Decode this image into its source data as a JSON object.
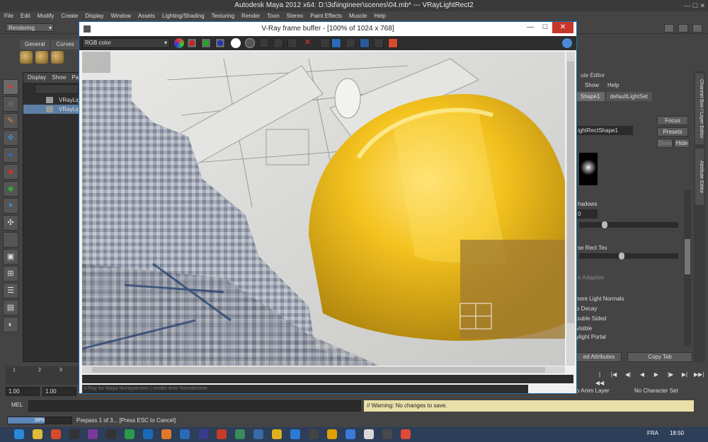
{
  "maya": {
    "title": "Autodesk Maya 2012 x64: D:\\3d\\ingineer\\scenes\\04.mb*   ---   VRayLightRect2",
    "menu": [
      "File",
      "Edit",
      "Modify",
      "Create",
      "Display",
      "Window",
      "Assets",
      "Lighting/Shading",
      "Texturing",
      "Render",
      "Toon",
      "Stereo",
      "Paint Effects",
      "Muscle",
      "Help"
    ],
    "mode": "Rendering",
    "shelf_tabs": [
      "General",
      "Curves"
    ]
  },
  "outliner": {
    "menu": [
      "Display",
      "Show",
      "Pa"
    ],
    "items": [
      "VRayLight",
      "VRayLigh"
    ]
  },
  "vfb": {
    "title": "V-Ray frame buffer - [100% of 1024 x 768]",
    "channel": "RGB color",
    "info_text": "V-Ray for Maya %vrayversion | render time %rendertime",
    "min_glyph": "—",
    "max_glyph": "☐",
    "close_glyph": "✕"
  },
  "attr_editor": {
    "title": "ute Editor",
    "menu": [
      "Show",
      "Help"
    ],
    "tabs": [
      "Shape1",
      "defaultLightSet"
    ],
    "node_field": "ightRectShape1",
    "focus": "Focus",
    "presets": "Presets",
    "show": "Show",
    "hide": "Hide",
    "shadows": "hadows",
    "shadows_value": "0",
    "rect_tex": "se Rect Tex",
    "adaptive": "e Adaptive",
    "checks": [
      "nore Light Normals",
      "o Decay",
      "ouble Sided",
      "visible",
      "ylight Portal"
    ],
    "select_attributes": "ed Attributes",
    "copy_tab": "Copy Tab"
  },
  "side_tabs": [
    "Channel Box / Layer Editor",
    "Attribute Editor"
  ],
  "timeline": {
    "ticks": [
      "1",
      "2",
      "3"
    ],
    "start": "1.00",
    "end": "1.00",
    "anim_layer": "o Anim Layer",
    "char_set": "No Character Set"
  },
  "cmd": {
    "label": "MEL",
    "result": "// Warning: No changes to save."
  },
  "help": {
    "progress_percent": 58,
    "progress_text": "58%",
    "text": "Prepass 1 of 3... [Press ESC to Cancel]"
  },
  "taskbar": {
    "lang": "FRA",
    "clock": "18:50",
    "icons": [
      "#2a88d8",
      "#e3b93a",
      "#d84a2a",
      "#333",
      "#7a3a9a",
      "#333",
      "#2a9a4a",
      "#1a6ab8",
      "#e07a2a",
      "#2a6ab8",
      "#3a3a8a",
      "#c83a2a",
      "#3a8a5a",
      "#3a6aa8",
      "#e0b020",
      "#2a7ad8",
      "#444",
      "#e0a000",
      "#3a7ad8",
      "#d8d8d8",
      "#4a4a4a",
      "#e04a3a"
    ]
  },
  "colors": {
    "vfb_close": "#c7362b",
    "selection": "#5d7fa3",
    "warning_bg": "#e8e0a8"
  }
}
